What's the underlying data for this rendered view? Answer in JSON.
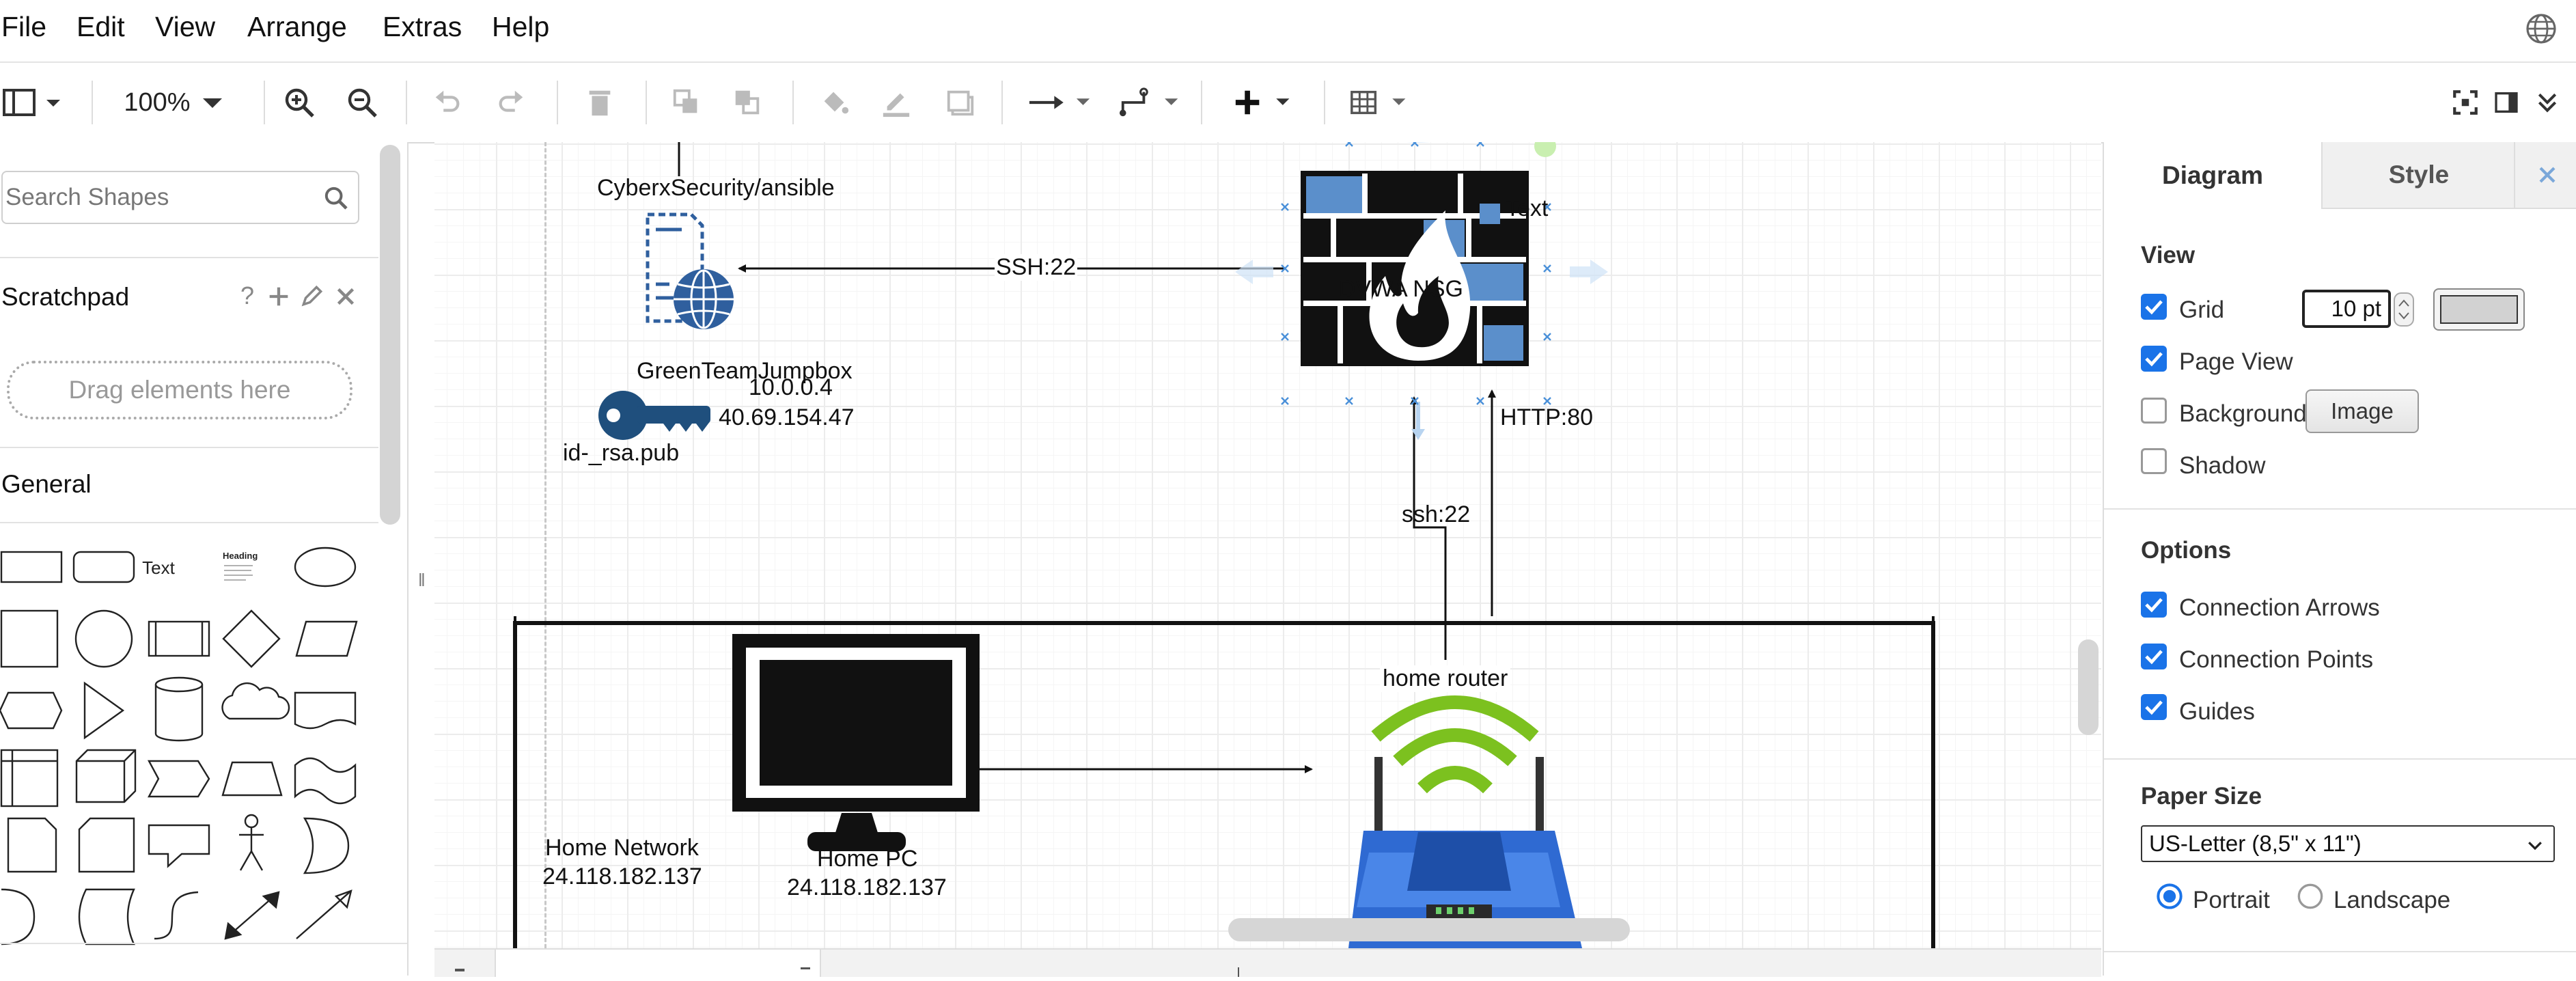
{
  "menu": [
    "File",
    "Edit",
    "View",
    "Arrange",
    "Extras",
    "Help"
  ],
  "toolbar": {
    "zoom": "100%"
  },
  "left_panel": {
    "search_placeholder": "Search Shapes",
    "scratchpad": {
      "title": "Scratchpad",
      "help": "?",
      "drop_hint": "Drag elements here"
    },
    "general": {
      "title": "General",
      "text_shape": "Text",
      "heading_shape": "Heading"
    }
  },
  "diagram": {
    "repo_label": "CyberxSecurity/ansible",
    "jumpbox": {
      "name": "GreenTeamJumpbox",
      "private_ip": "10.0.0.4",
      "public_ip": "40.69.154.47"
    },
    "key_label": "id-_rsa.pub",
    "ssh_edge": "SSH:22",
    "nsg": {
      "name": "DVWA NSG",
      "overlay": "Text"
    },
    "http_edge": "HTTP:80",
    "router_ssh_edge": "ssh:22",
    "router": {
      "name": "home router"
    },
    "home_network": {
      "name": "Home Network",
      "ip": "24.118.182.137"
    },
    "home_pc": {
      "name": "Home PC",
      "ip": "24.118.182.137"
    }
  },
  "right_panel": {
    "tabs": [
      "Diagram",
      "Style"
    ],
    "view": {
      "title": "View",
      "grid": {
        "label": "Grid",
        "checked": true,
        "size": "10 pt"
      },
      "page_view": {
        "label": "Page View",
        "checked": true
      },
      "background": {
        "label": "Background",
        "checked": false,
        "button": "Image"
      },
      "shadow": {
        "label": "Shadow",
        "checked": false
      }
    },
    "options": {
      "title": "Options",
      "connection_arrows": {
        "label": "Connection Arrows",
        "checked": true
      },
      "connection_points": {
        "label": "Connection Points",
        "checked": true
      },
      "guides": {
        "label": "Guides",
        "checked": true
      }
    },
    "paper": {
      "title": "Paper Size",
      "selected": "US-Letter (8,5\" x 11\")",
      "orientation": {
        "portrait": "Portrait",
        "landscape": "Landscape",
        "selected": "Portrait"
      }
    }
  },
  "colors": {
    "accent": "#1a73e8",
    "router_green": "#7cc11f",
    "router_blue": "#2f6ad2"
  }
}
